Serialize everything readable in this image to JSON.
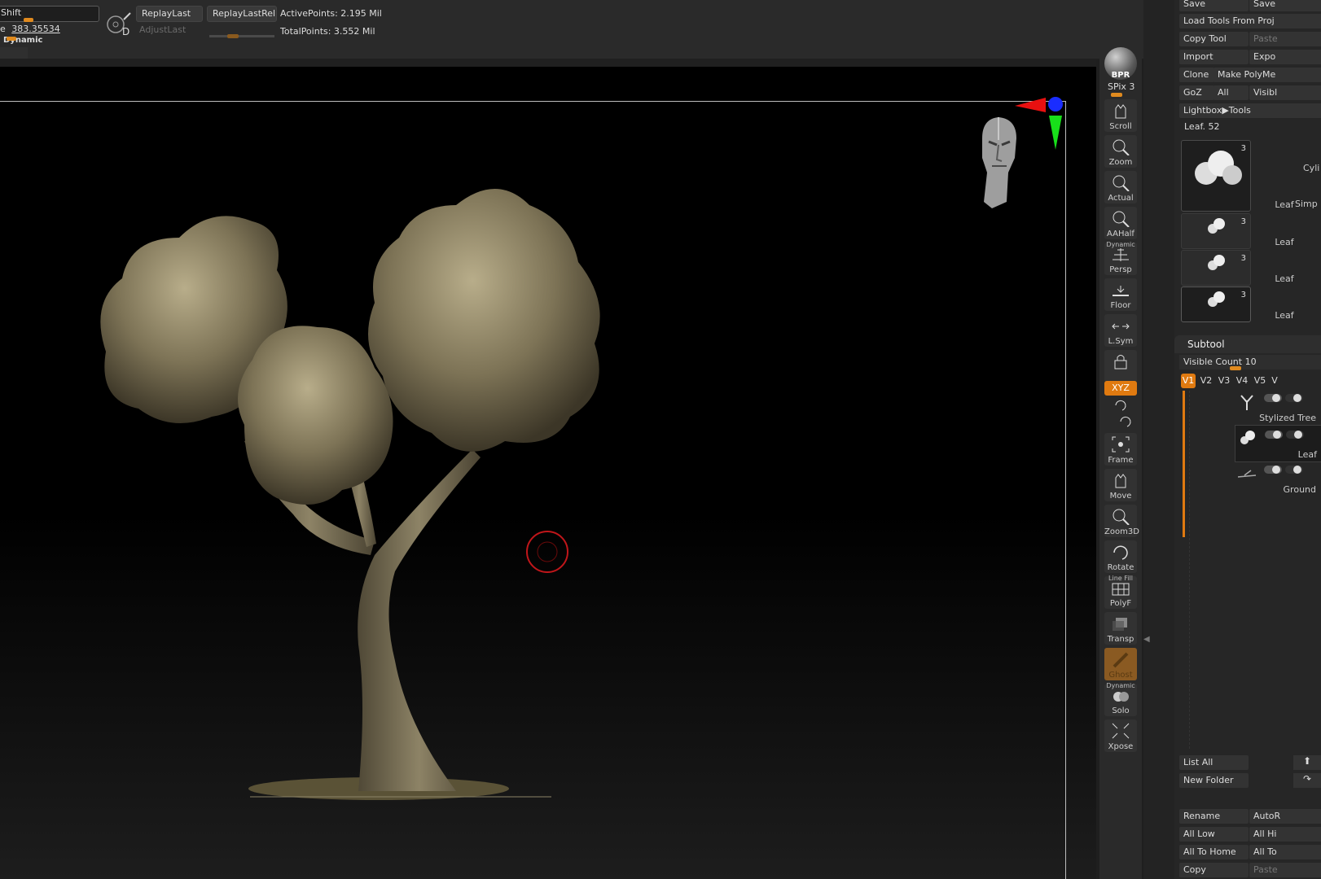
{
  "topbar": {
    "shift_label": "Shift",
    "size_prefix": "e",
    "size_value": "383.35534",
    "dynamic_label": "Dynamic",
    "replay_last": "ReplayLast",
    "replay_last_rel": "ReplayLastRel",
    "adjust_last": "AdjustLast",
    "active_points": "ActivePoints: 2.195 Mil",
    "total_points": "TotalPoints: 3.552 Mil",
    "d_label": "D",
    "left_tab": "O"
  },
  "shelf": {
    "bpr": "BPR",
    "spix": "SPix 3",
    "items": [
      "Scroll",
      "Zoom",
      "Actual",
      "AAHalf",
      "Persp",
      "Floor",
      "L.Sym",
      "",
      "Frame",
      "Move",
      "Zoom3D",
      "Rotate",
      "PolyF",
      "Transp",
      "Ghost",
      "Solo",
      "Xpose"
    ],
    "xyz": "XYZ",
    "persp_top": "Dynamic",
    "polyf_top": "Line Fill",
    "solo_top": "Dynamic"
  },
  "rightpanel": {
    "save1": "Save",
    "save2": "Save",
    "load_tools": "Load Tools From Proj",
    "copy_tool": "Copy Tool",
    "paste": "Paste",
    "import": "Import",
    "export": "Expo",
    "clone": "Clone",
    "make_polymesh": "Make PolyMe",
    "goz": "GoZ",
    "all": "All",
    "visible": "Visibl",
    "lightbox_tools": "Lightbox▶Tools",
    "leaf_count": "Leaf. 52",
    "thumbs": [
      {
        "label": "Leaf",
        "num": "3"
      },
      {
        "label": "Leaf",
        "num": "3"
      },
      {
        "label": "Leaf",
        "num": "3"
      },
      {
        "label": "Leaf",
        "num": "3"
      }
    ],
    "thumb_side_top": "Cyli",
    "thumb_side_bottom": "Simp",
    "subtool_title": "Subtool",
    "visible_count": "Visible Count 10",
    "vtabs": [
      "V1",
      "V2",
      "V3",
      "V4",
      "V5",
      "V"
    ],
    "subtools": [
      "Stylized Tree",
      "Leaf",
      "Ground"
    ],
    "list_all": "List All",
    "new_folder": "New Folder",
    "rename": "Rename",
    "autoreorder": "AutoR",
    "all_low": "All Low",
    "all_high": "All Hi",
    "all_to_home": "All To Home",
    "all_to": "All To",
    "copy": "Copy",
    "paste2": "Paste"
  }
}
